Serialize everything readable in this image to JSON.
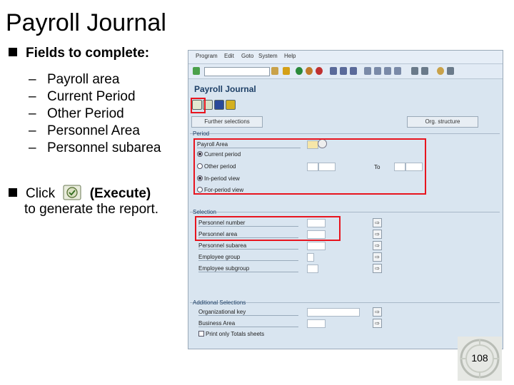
{
  "slide": {
    "title": "Payroll Journal",
    "fields_header": "Fields to complete:",
    "fields": [
      {
        "dash": "–",
        "label": "Payroll area"
      },
      {
        "dash": "–",
        "label": "Current Period"
      },
      {
        "dash": "–",
        "label": "Other Period"
      },
      {
        "dash": "–",
        "label": "Personnel Area"
      },
      {
        "dash": "–",
        "label": "Personnel subarea"
      }
    ],
    "click_prefix": "Click",
    "click_action": "(Execute)",
    "click_suffix": "to generate the report.",
    "page_number": "108"
  },
  "sap": {
    "menu": [
      "Program",
      "Edit",
      "Goto",
      "System",
      "Help"
    ],
    "screen_title": "Payroll Journal",
    "buttons": {
      "further_selections": "Further selections",
      "org_structure": "Org. structure"
    },
    "period_group": {
      "label": "Period",
      "payroll_area": "Payroll Area",
      "current_period": "Current period",
      "other_period": "Other period",
      "to": "To",
      "in_period_view": "In-period view",
      "for_period_view": "For-period view"
    },
    "selection_group": {
      "label": "Selection",
      "rows": [
        "Personnel number",
        "Personnel area",
        "Personnel subarea",
        "Employee group",
        "Employee subgroup"
      ]
    },
    "additional_group": {
      "label": "Additional Selections",
      "rows": [
        "Organizational key",
        "Business Area"
      ],
      "print_totals": "Print only Totals sheets"
    },
    "colors": {
      "highlight": "#e8141e",
      "window_bg": "#d9e5f0",
      "title": "#1d3f66"
    }
  }
}
